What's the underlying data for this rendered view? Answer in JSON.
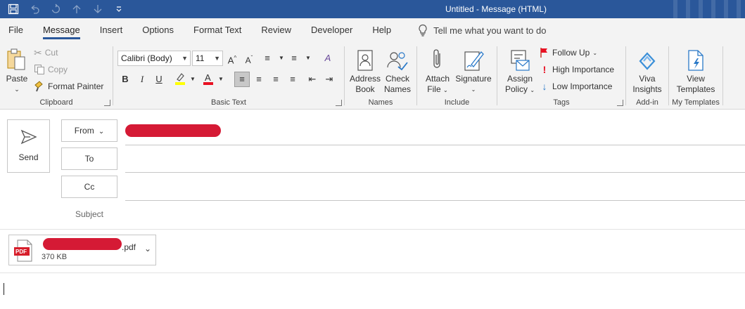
{
  "window": {
    "title": "Untitled  -  Message (HTML)"
  },
  "quick_access": [
    "save-icon",
    "undo-icon",
    "redo-icon",
    "up-icon",
    "down-icon",
    "customize-icon"
  ],
  "tabs": [
    "File",
    "Message",
    "Insert",
    "Options",
    "Format Text",
    "Review",
    "Developer",
    "Help"
  ],
  "active_tab": "Message",
  "tell_me": "Tell me what you want to do",
  "ribbon": {
    "clipboard": {
      "label": "Clipboard",
      "paste": "Paste",
      "cut": "Cut",
      "copy": "Copy",
      "format_painter": "Format Painter"
    },
    "basic_text": {
      "label": "Basic Text",
      "font": "Calibri (Body)",
      "size": "11"
    },
    "names": {
      "label": "Names",
      "address_book_1": "Address",
      "address_book_2": "Book",
      "check_names_1": "Check",
      "check_names_2": "Names"
    },
    "include": {
      "label": "Include",
      "attach_1": "Attach",
      "attach_2": "File",
      "signature": "Signature"
    },
    "tags": {
      "label": "Tags",
      "assign_1": "Assign",
      "assign_2": "Policy",
      "follow_up": "Follow Up",
      "high": "High Importance",
      "low": "Low Importance"
    },
    "addin": {
      "label": "Add-in",
      "viva_1": "Viva",
      "viva_2": "Insights"
    },
    "templates": {
      "label": "My Templates",
      "view_1": "View",
      "view_2": "Templates"
    }
  },
  "compose": {
    "send": "Send",
    "from": "From",
    "to": "To",
    "cc": "Cc",
    "subject": "Subject",
    "to_value": "",
    "cc_value": "",
    "subject_value": ""
  },
  "attachment": {
    "name_suffix": ".pdf",
    "size": "370 KB",
    "badge": "PDF"
  },
  "colors": {
    "title_bar": "#2a579a",
    "redaction": "#d51a35",
    "highlight": "#ffff00",
    "font_color": "#e81123"
  }
}
